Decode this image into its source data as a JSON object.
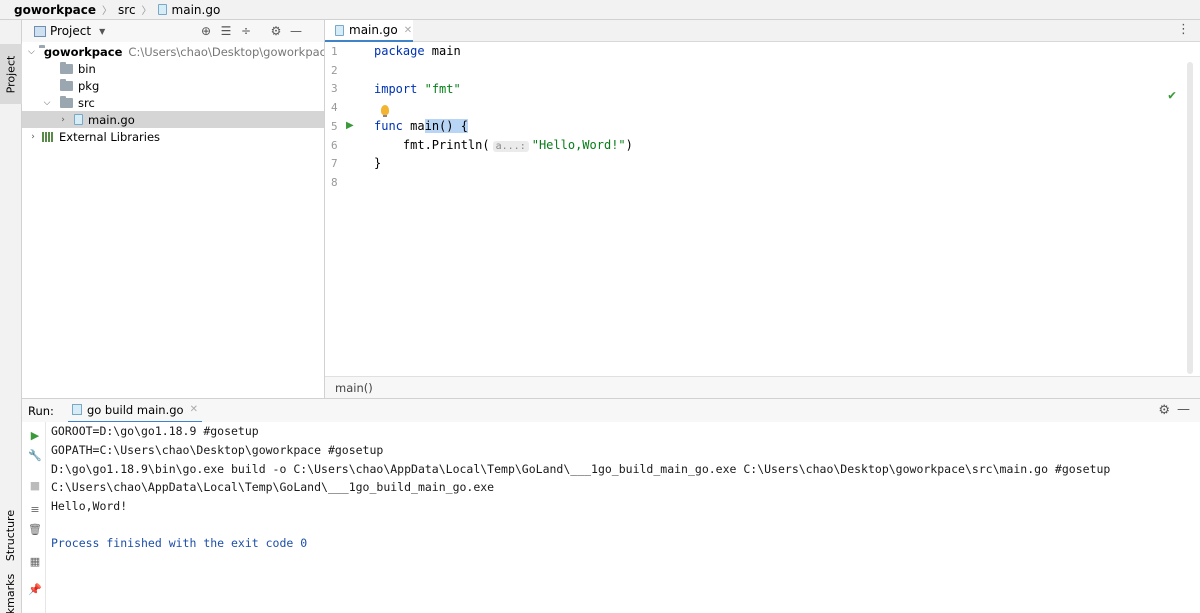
{
  "breadcrumb": {
    "root": "goworkpace",
    "folder": "src",
    "file": "main.go"
  },
  "tool_windows": {
    "project": "Project",
    "structure": "Structure",
    "bookmarks": "Bookmarks"
  },
  "project_panel": {
    "title": "Project",
    "tree": {
      "root": {
        "name": "goworkpace",
        "path": "C:\\Users\\chao\\Desktop\\goworkpace"
      },
      "bin": "bin",
      "pkg": "pkg",
      "src": "src",
      "file": "main.go",
      "external": "External Libraries"
    }
  },
  "editor": {
    "tab_label": "main.go",
    "line_numbers": [
      "1",
      "2",
      "3",
      "4",
      "5",
      "6",
      "7",
      "8"
    ],
    "code": {
      "l1_kw": "package",
      "l1_rest": " main",
      "l3_kw": "import",
      "l3_str": "\"fmt\"",
      "l5_kw": "func",
      "l5_fn_a": "ma",
      "l5_fn_b": "in",
      "l5_rest": "() {",
      "l6_call": "fmt.Println(",
      "l6_hint": "a...:",
      "l6_str": "\"Hello,Word!\"",
      "l6_end": ")",
      "l7": "}"
    },
    "status_text": "main()"
  },
  "run_panel": {
    "label": "Run:",
    "tab_label": "go build main.go",
    "console": [
      "GOROOT=D:\\go\\go1.18.9 #gosetup",
      "GOPATH=C:\\Users\\chao\\Desktop\\goworkpace #gosetup",
      "D:\\go\\go1.18.9\\bin\\go.exe build -o C:\\Users\\chao\\AppData\\Local\\Temp\\GoLand\\___1go_build_main_go.exe C:\\Users\\chao\\Desktop\\goworkpace\\src\\main.go #gosetup",
      "C:\\Users\\chao\\AppData\\Local\\Temp\\GoLand\\___1go_build_main_go.exe",
      "Hello,Word!",
      "",
      "Process finished with the exit code 0"
    ]
  }
}
